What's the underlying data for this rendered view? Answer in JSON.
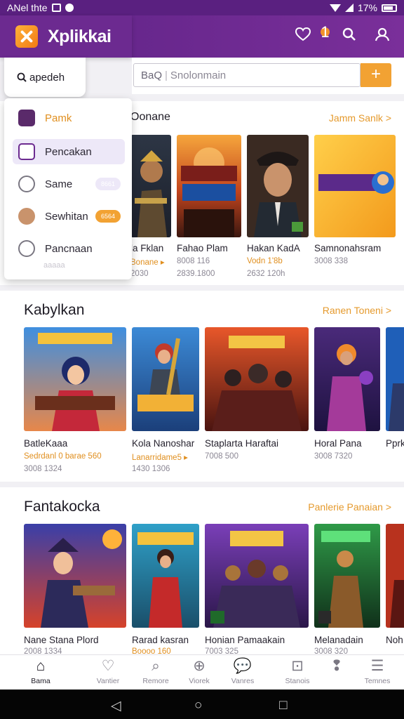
{
  "status_bar": {
    "left_text": "ANel thte",
    "right_text": "17%"
  },
  "app": {
    "name": "Xplikkai",
    "colors": {
      "primary": "#6c2a90",
      "accent": "#f2a233"
    }
  },
  "topbar": {
    "icons": [
      "heart-icon",
      "search-icon",
      "profile-icon"
    ],
    "notification_badge": "1"
  },
  "account": {
    "label": "apedeh"
  },
  "search": {
    "prefix": "BaQ",
    "placeholder": "Snolonmain",
    "add_label": "+"
  },
  "menu": {
    "items": [
      {
        "label": "Pamk",
        "badge": ""
      },
      {
        "label": "Pencakan",
        "badge": ""
      },
      {
        "label": "Same",
        "badge": "8661"
      },
      {
        "label": "Sewhitan",
        "badge": "6564"
      },
      {
        "label": "Pancnaan",
        "badge": ""
      }
    ],
    "faded_text": "ааааа"
  },
  "sections": [
    {
      "title": "Oonane",
      "link": "Jamm Sanlk >",
      "cards": [
        {
          "title": "la Fklan",
          "sub": "Bonane ▸",
          "meta": "2030"
        },
        {
          "title": "Fahao Plam",
          "sub": "8008 116",
          "meta": "2839.1800"
        },
        {
          "title": "Hakan KadA",
          "sub": "Vodn 1'8b",
          "meta": "2632 120h"
        },
        {
          "title": "Samnonahsram",
          "sub": "3008 338",
          "meta": ""
        }
      ]
    },
    {
      "title": "Kabylkan",
      "link": "Ranen Toneni >",
      "cards": [
        {
          "title": "BatleKaaa",
          "sub": "Sedrdanl 0 barae 560",
          "meta": "3008 1324"
        },
        {
          "title": "Kola Nanoshar",
          "sub": "Lanarridame5 ▸",
          "meta": "1430 1306"
        },
        {
          "title": "Staplarta Haraftai",
          "sub": "7008 500",
          "meta": ""
        },
        {
          "title": "Horal Pana",
          "sub": "3008 7320",
          "meta": ""
        },
        {
          "title": "Pprk",
          "sub": "",
          "meta": ""
        }
      ]
    },
    {
      "title": "Fantakocka",
      "link": "Panlerie Panaian >",
      "cards": [
        {
          "title": "Nane Stana Plord",
          "sub": "2008 1334",
          "meta": ""
        },
        {
          "title": "Rarad kasran",
          "sub": "Boooo 160",
          "meta": ""
        },
        {
          "title": "Honian Pamaakain",
          "sub": "7003 325",
          "meta": ""
        },
        {
          "title": "Melanadain",
          "sub": "3008 320",
          "meta": ""
        },
        {
          "title": "Noh",
          "sub": "",
          "meta": ""
        }
      ]
    }
  ],
  "bottom_nav": [
    {
      "label": "Bama",
      "icon": "home-icon"
    },
    {
      "label": "Vantier",
      "icon": "heart-icon"
    },
    {
      "label": "Remore",
      "icon": "search-icon"
    },
    {
      "label": "Viorek",
      "icon": "add-icon"
    },
    {
      "label": "Vanres",
      "icon": "chat-icon"
    },
    {
      "label": "Stanois",
      "icon": "bag-icon"
    },
    {
      "label": "",
      "icon": "hint-icon"
    },
    {
      "label": "Temnes",
      "icon": "menu-icon"
    }
  ]
}
